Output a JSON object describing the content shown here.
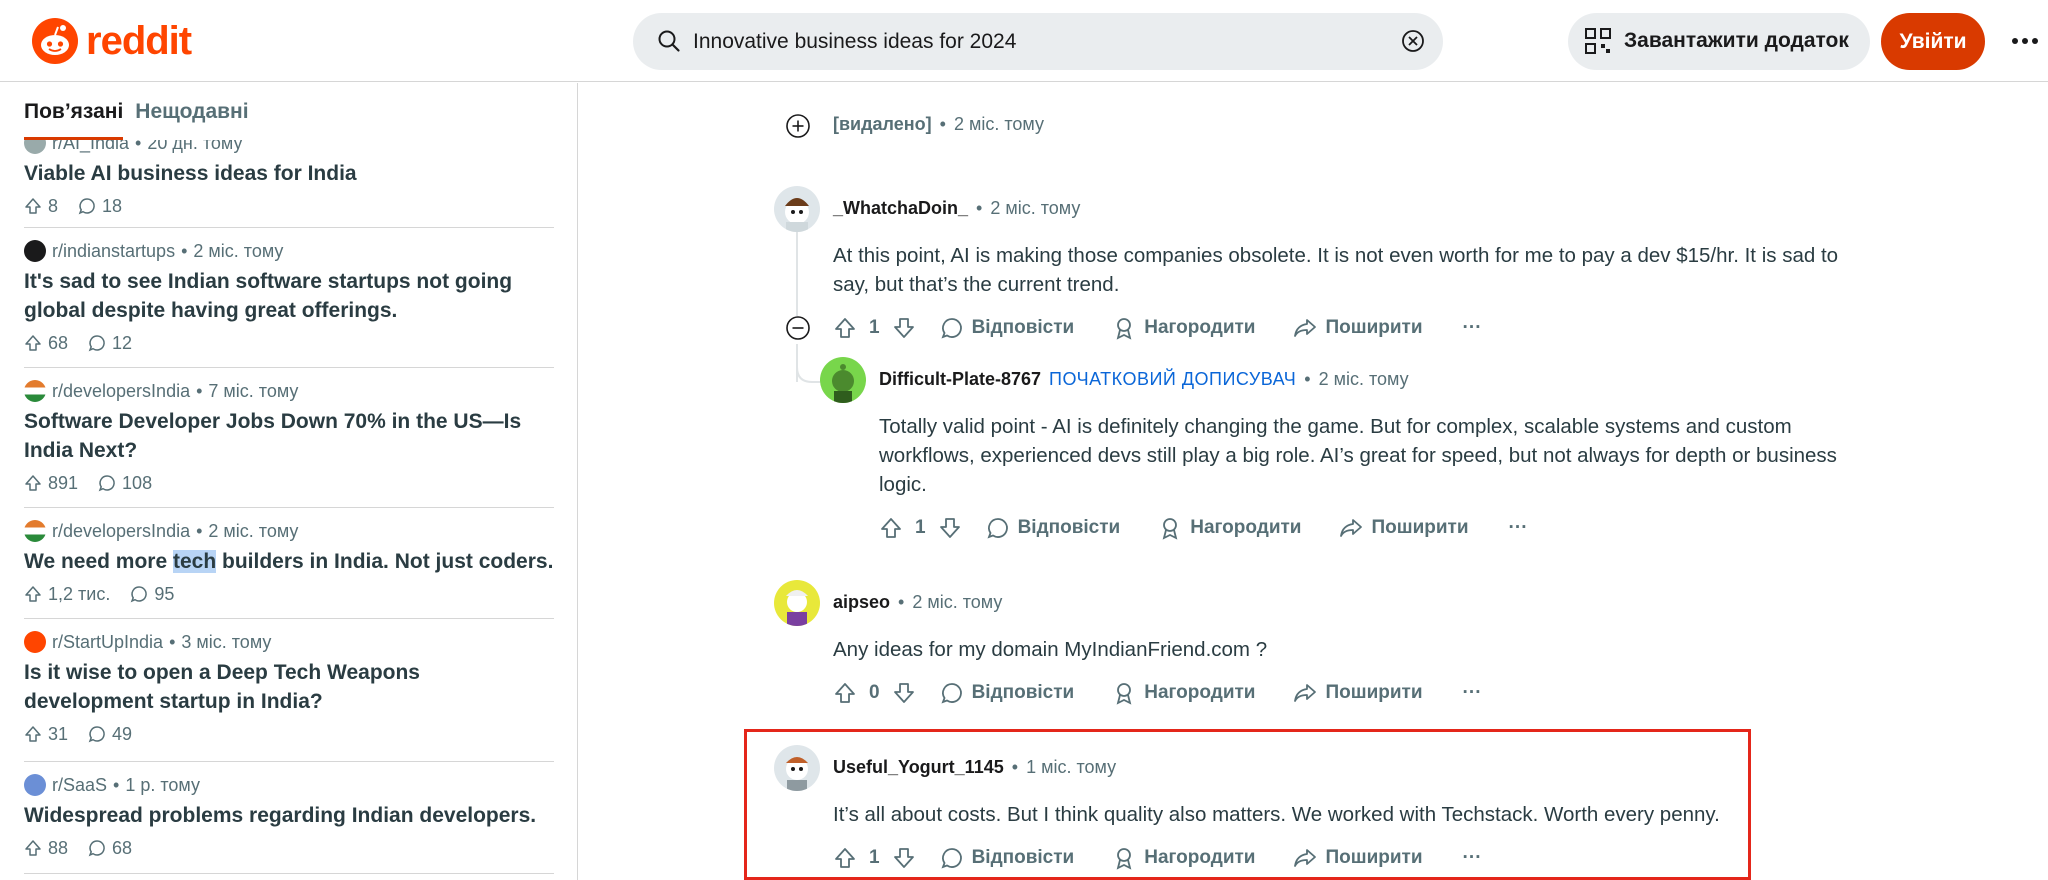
{
  "header": {
    "logo_text": "reddit",
    "search_value": "Innovative business ideas for 2024",
    "get_app_label": "Завантажити додаток",
    "login_label": "Увійти",
    "brand_color": "#ff4500"
  },
  "sidebar": {
    "tabs": [
      {
        "label": "Пов’язані"
      },
      {
        "label": "Нещодавні"
      }
    ],
    "posts": [
      {
        "sub": "r/AI_India",
        "age": "20 дн. тому",
        "title": "Viable AI business ideas for India",
        "votes": "8",
        "comments": "18"
      },
      {
        "sub": "r/indianstartups",
        "age": "2 міс. тому",
        "title": "It's sad to see Indian software startups not going global despite having great offerings.",
        "votes": "68",
        "comments": "12"
      },
      {
        "sub": "r/developersIndia",
        "age": "7 міс. тому",
        "title": "Software Developer Jobs Down 70% in the US—Is India Next?",
        "votes": "891",
        "comments": "108"
      },
      {
        "sub": "r/developersIndia",
        "age": "2 міс. тому",
        "title_pre": "We need more ",
        "title_hl": "tech",
        "title_post": " builders in India. Not just coders.",
        "votes": "1,2 тис.",
        "comments": "95"
      },
      {
        "sub": "r/StartUpIndia",
        "age": "3 міс. тому",
        "title": "Is it wise to open a Deep Tech Weapons development startup in India?",
        "votes": "31",
        "comments": "49"
      },
      {
        "sub": "r/SaaS",
        "age": "1 р. тому",
        "title": "Widespread problems regarding Indian developers.",
        "votes": "88",
        "comments": "68"
      }
    ]
  },
  "comments": {
    "sep": "•",
    "deleted": {
      "user": "[видалено]",
      "age": "2 міс. тому"
    },
    "c1": {
      "user": "_WhatchaDoin_",
      "age": "2 міс. тому",
      "text": "At this point, AI is making those companies obsolete. It is not even worth for me to pay a dev $15/hr. It is sad to say, but that’s the current trend.",
      "votes": "1"
    },
    "c2": {
      "user": "Difficult-Plate-8767",
      "flair": "ПОЧАТКОВИЙ ДОПИСУВАЧ",
      "age": "2 міс. тому",
      "text": "Totally valid point - AI is definitely changing the game. But for complex, scalable systems and custom workflows, experienced devs still play a big role. AI’s great for speed, but not always for depth or business logic.",
      "votes": "1"
    },
    "c3": {
      "user": "aipseo",
      "age": "2 міс. тому",
      "text": "Any ideas for my domain MyIndianFriend.com ?",
      "votes": "0"
    },
    "c4": {
      "user": "Useful_Yogurt_1145",
      "age": "1 міс. тому",
      "text": "It’s all about costs. But I think quality also matters. We worked with Techstack. Worth every penny.",
      "votes": "1"
    },
    "reply_label": "Відповісти",
    "award_label": "Нагородити",
    "share_label": "Поширити",
    "more_label": "···"
  }
}
